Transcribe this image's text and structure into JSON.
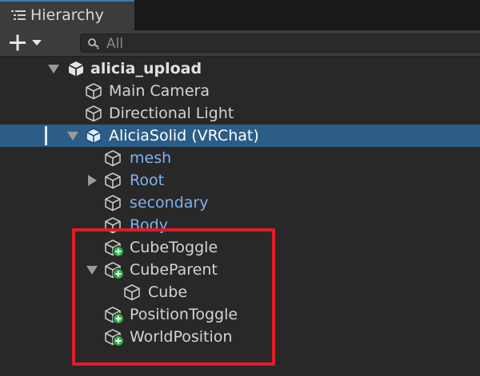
{
  "window": {
    "tab_title": "Hierarchy",
    "tab_icon": "hierarchy-list-icon"
  },
  "toolbar": {
    "add_button_icon": "plus-icon",
    "dropdown_icon": "caret-down-icon",
    "search_placeholder": "All",
    "search_icon": "search-icon"
  },
  "tree": {
    "rows": [
      {
        "label": "alicia_upload",
        "style": "root",
        "icon": "unity-scene-icon",
        "arrow": "down"
      },
      {
        "label": "Main Camera",
        "style": "normal",
        "icon": "gameobject-cube-icon"
      },
      {
        "label": "Directional Light",
        "style": "normal",
        "icon": "gameobject-cube-icon"
      },
      {
        "label": "AliciaSolid (VRChat)",
        "style": "selected",
        "icon": "prefab-cube-icon",
        "arrow": "down",
        "selected": true
      },
      {
        "label": "mesh",
        "style": "prefab",
        "icon": "gameobject-cube-icon"
      },
      {
        "label": "Root",
        "style": "prefab",
        "icon": "gameobject-cube-icon",
        "arrow": "right"
      },
      {
        "label": "secondary",
        "style": "prefab",
        "icon": "gameobject-cube-icon"
      },
      {
        "label": "Body",
        "style": "prefab",
        "icon": "gameobject-cube-icon"
      },
      {
        "label": "CubeToggle",
        "style": "normal",
        "icon": "added-gameobject-icon"
      },
      {
        "label": "CubeParent",
        "style": "normal",
        "icon": "added-gameobject-icon",
        "arrow": "down"
      },
      {
        "label": "Cube",
        "style": "normal",
        "icon": "gameobject-cube-icon"
      },
      {
        "label": "PositionToggle",
        "style": "normal",
        "icon": "added-gameobject-icon"
      },
      {
        "label": "WorldPosition",
        "style": "normal",
        "icon": "added-gameobject-icon"
      }
    ]
  },
  "annotation": {
    "highlight_color": "#e11c27"
  },
  "colors": {
    "background": "#282828",
    "selection": "#2c5d87",
    "prefab_text": "#7fb2f0",
    "added_badge": "#2bb24c"
  }
}
